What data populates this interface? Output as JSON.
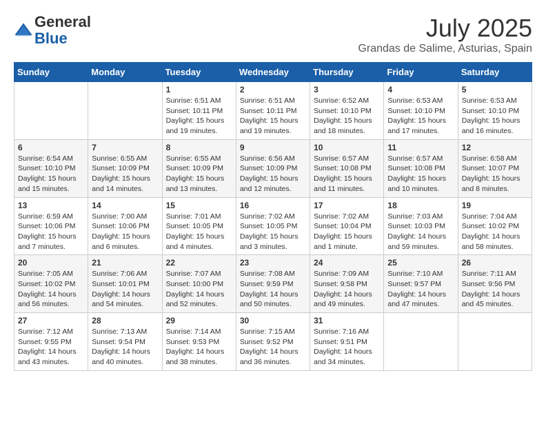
{
  "header": {
    "logo_line1": "General",
    "logo_line2": "Blue",
    "month_year": "July 2025",
    "location": "Grandas de Salime, Asturias, Spain"
  },
  "days_of_week": [
    "Sunday",
    "Monday",
    "Tuesday",
    "Wednesday",
    "Thursday",
    "Friday",
    "Saturday"
  ],
  "weeks": [
    [
      {
        "day": "",
        "info": ""
      },
      {
        "day": "",
        "info": ""
      },
      {
        "day": "1",
        "info": "Sunrise: 6:51 AM\nSunset: 10:11 PM\nDaylight: 15 hours and 19 minutes."
      },
      {
        "day": "2",
        "info": "Sunrise: 6:51 AM\nSunset: 10:11 PM\nDaylight: 15 hours and 19 minutes."
      },
      {
        "day": "3",
        "info": "Sunrise: 6:52 AM\nSunset: 10:10 PM\nDaylight: 15 hours and 18 minutes."
      },
      {
        "day": "4",
        "info": "Sunrise: 6:53 AM\nSunset: 10:10 PM\nDaylight: 15 hours and 17 minutes."
      },
      {
        "day": "5",
        "info": "Sunrise: 6:53 AM\nSunset: 10:10 PM\nDaylight: 15 hours and 16 minutes."
      }
    ],
    [
      {
        "day": "6",
        "info": "Sunrise: 6:54 AM\nSunset: 10:10 PM\nDaylight: 15 hours and 15 minutes."
      },
      {
        "day": "7",
        "info": "Sunrise: 6:55 AM\nSunset: 10:09 PM\nDaylight: 15 hours and 14 minutes."
      },
      {
        "day": "8",
        "info": "Sunrise: 6:55 AM\nSunset: 10:09 PM\nDaylight: 15 hours and 13 minutes."
      },
      {
        "day": "9",
        "info": "Sunrise: 6:56 AM\nSunset: 10:09 PM\nDaylight: 15 hours and 12 minutes."
      },
      {
        "day": "10",
        "info": "Sunrise: 6:57 AM\nSunset: 10:08 PM\nDaylight: 15 hours and 11 minutes."
      },
      {
        "day": "11",
        "info": "Sunrise: 6:57 AM\nSunset: 10:08 PM\nDaylight: 15 hours and 10 minutes."
      },
      {
        "day": "12",
        "info": "Sunrise: 6:58 AM\nSunset: 10:07 PM\nDaylight: 15 hours and 8 minutes."
      }
    ],
    [
      {
        "day": "13",
        "info": "Sunrise: 6:59 AM\nSunset: 10:06 PM\nDaylight: 15 hours and 7 minutes."
      },
      {
        "day": "14",
        "info": "Sunrise: 7:00 AM\nSunset: 10:06 PM\nDaylight: 15 hours and 6 minutes."
      },
      {
        "day": "15",
        "info": "Sunrise: 7:01 AM\nSunset: 10:05 PM\nDaylight: 15 hours and 4 minutes."
      },
      {
        "day": "16",
        "info": "Sunrise: 7:02 AM\nSunset: 10:05 PM\nDaylight: 15 hours and 3 minutes."
      },
      {
        "day": "17",
        "info": "Sunrise: 7:02 AM\nSunset: 10:04 PM\nDaylight: 15 hours and 1 minute."
      },
      {
        "day": "18",
        "info": "Sunrise: 7:03 AM\nSunset: 10:03 PM\nDaylight: 14 hours and 59 minutes."
      },
      {
        "day": "19",
        "info": "Sunrise: 7:04 AM\nSunset: 10:02 PM\nDaylight: 14 hours and 58 minutes."
      }
    ],
    [
      {
        "day": "20",
        "info": "Sunrise: 7:05 AM\nSunset: 10:02 PM\nDaylight: 14 hours and 56 minutes."
      },
      {
        "day": "21",
        "info": "Sunrise: 7:06 AM\nSunset: 10:01 PM\nDaylight: 14 hours and 54 minutes."
      },
      {
        "day": "22",
        "info": "Sunrise: 7:07 AM\nSunset: 10:00 PM\nDaylight: 14 hours and 52 minutes."
      },
      {
        "day": "23",
        "info": "Sunrise: 7:08 AM\nSunset: 9:59 PM\nDaylight: 14 hours and 50 minutes."
      },
      {
        "day": "24",
        "info": "Sunrise: 7:09 AM\nSunset: 9:58 PM\nDaylight: 14 hours and 49 minutes."
      },
      {
        "day": "25",
        "info": "Sunrise: 7:10 AM\nSunset: 9:57 PM\nDaylight: 14 hours and 47 minutes."
      },
      {
        "day": "26",
        "info": "Sunrise: 7:11 AM\nSunset: 9:56 PM\nDaylight: 14 hours and 45 minutes."
      }
    ],
    [
      {
        "day": "27",
        "info": "Sunrise: 7:12 AM\nSunset: 9:55 PM\nDaylight: 14 hours and 43 minutes."
      },
      {
        "day": "28",
        "info": "Sunrise: 7:13 AM\nSunset: 9:54 PM\nDaylight: 14 hours and 40 minutes."
      },
      {
        "day": "29",
        "info": "Sunrise: 7:14 AM\nSunset: 9:53 PM\nDaylight: 14 hours and 38 minutes."
      },
      {
        "day": "30",
        "info": "Sunrise: 7:15 AM\nSunset: 9:52 PM\nDaylight: 14 hours and 36 minutes."
      },
      {
        "day": "31",
        "info": "Sunrise: 7:16 AM\nSunset: 9:51 PM\nDaylight: 14 hours and 34 minutes."
      },
      {
        "day": "",
        "info": ""
      },
      {
        "day": "",
        "info": ""
      }
    ]
  ]
}
